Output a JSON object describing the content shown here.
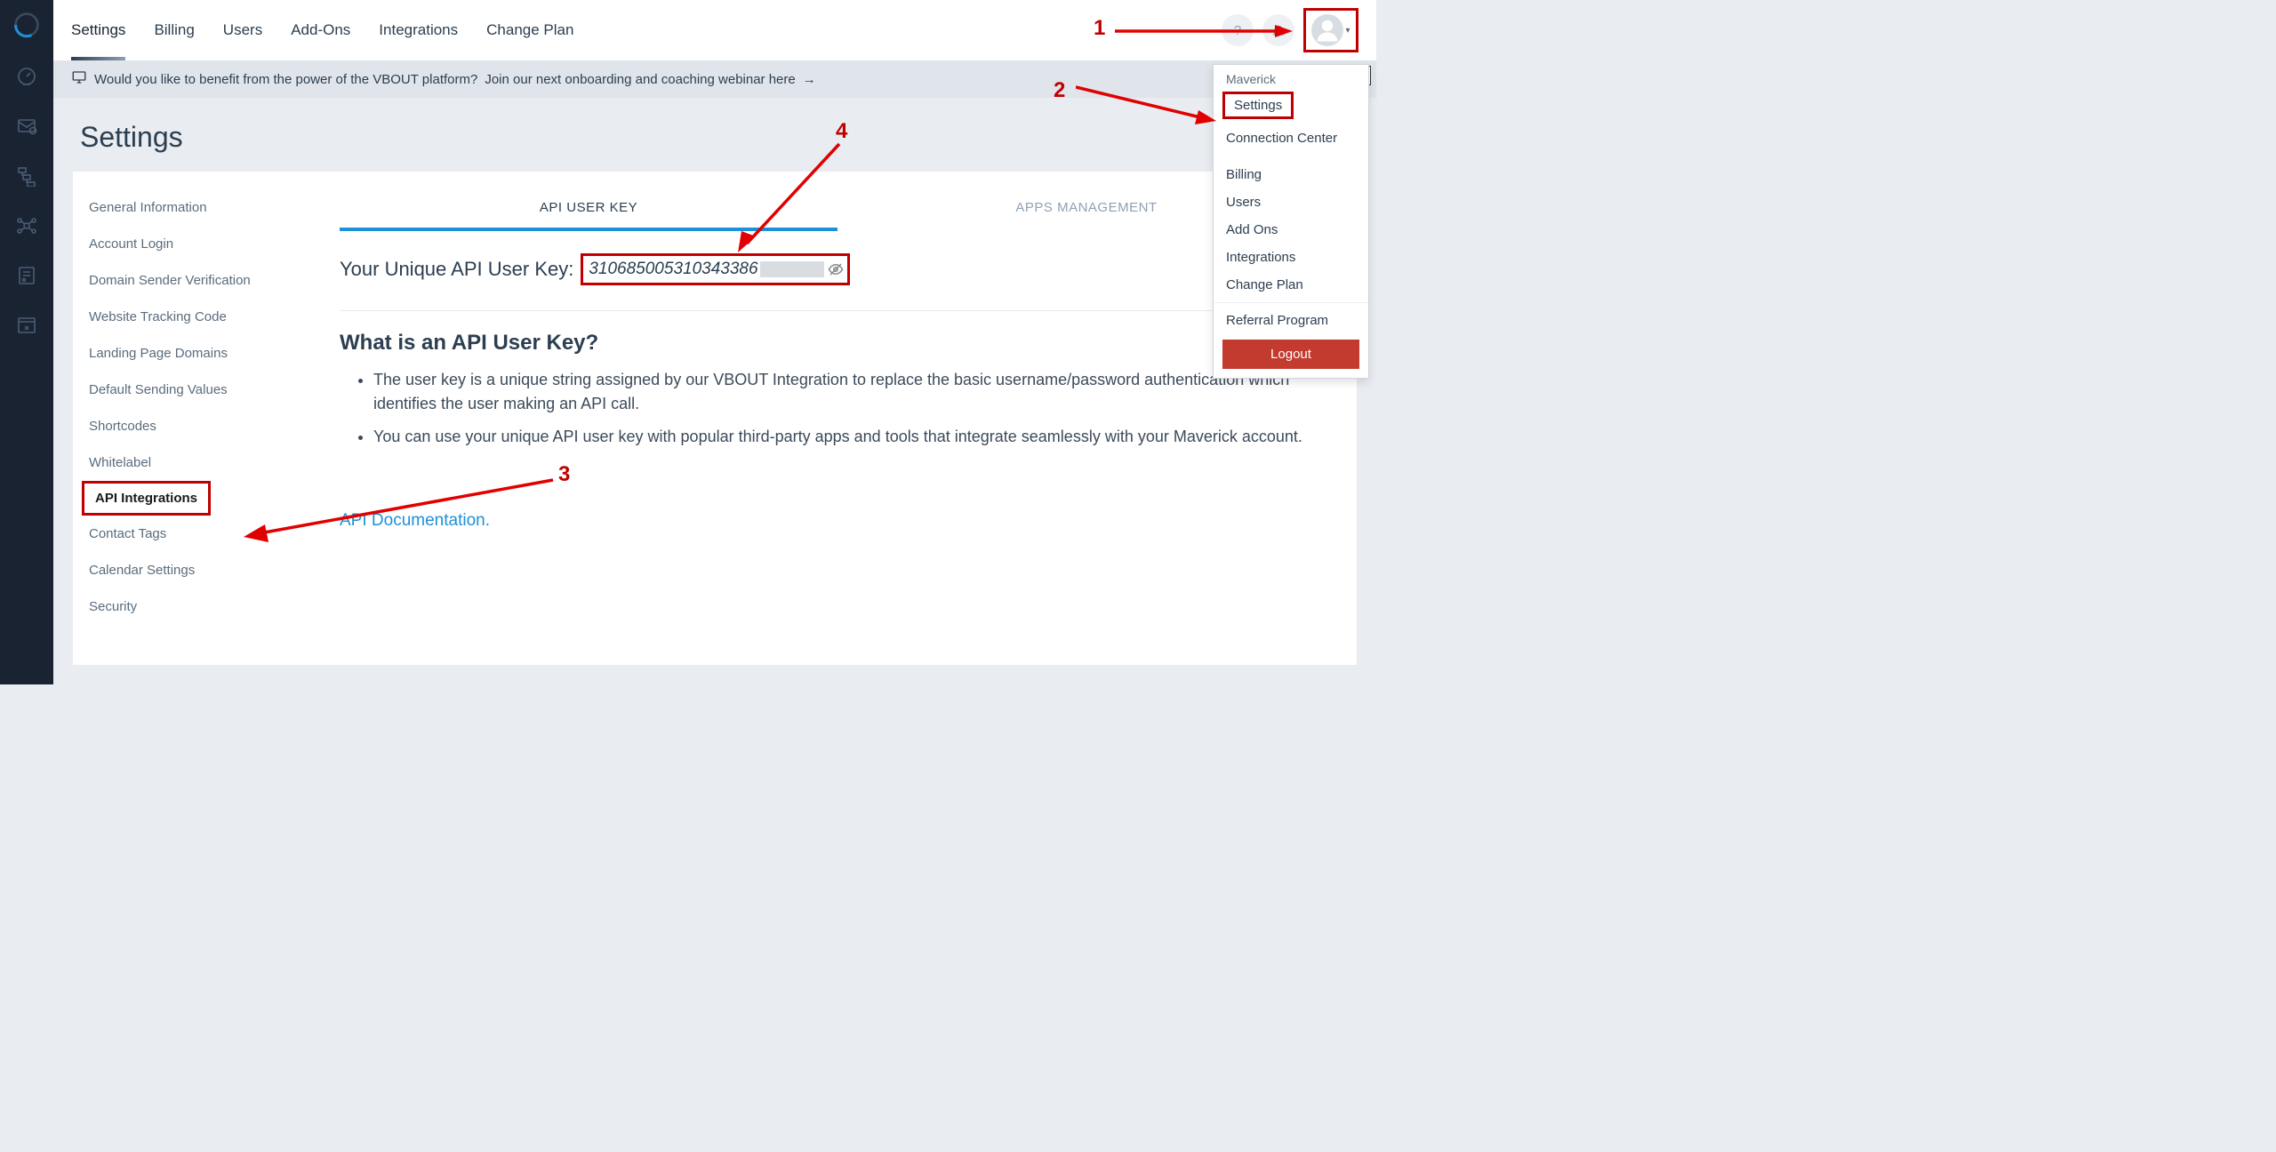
{
  "topTabs": {
    "settings": "Settings",
    "billing": "Billing",
    "users": "Users",
    "addons": "Add-Ons",
    "integrations": "Integrations",
    "changePlan": "Change Plan"
  },
  "banner": {
    "prefix": "Would you like to benefit from the power of the VBOUT platform? ",
    "link": "Join our next onboarding and coaching webinar here"
  },
  "pageTitle": "Settings",
  "settingsNav": {
    "general": "General Information",
    "accountLogin": "Account Login",
    "domainSender": "Domain Sender Verification",
    "tracking": "Website Tracking Code",
    "landing": "Landing Page Domains",
    "defaultSending": "Default Sending Values",
    "shortcodes": "Shortcodes",
    "whitelabel": "Whitelabel",
    "apiIntegrations": "API Integrations",
    "contactTags": "Contact Tags",
    "calendar": "Calendar Settings",
    "security": "Security"
  },
  "panelTabs": {
    "apiUserKey": "API USER KEY",
    "appsManagement": "APPS MANAGEMENT"
  },
  "apiKey": {
    "label": "Your Unique API User Key:",
    "value": "310685005310343386"
  },
  "whatIs": {
    "heading": "What is an API User Key?",
    "b1": "The user key is a unique string assigned by our VBOUT Integration to replace the basic username/password authentication which identifies the user making an API call.",
    "b2": "You can use your unique API user key with popular third-party apps and tools that integrate seamlessly with your Maverick account."
  },
  "docLink": "API Documentation.",
  "dropdown": {
    "name": "Maverick",
    "settings": "Settings",
    "connection": "Connection Center",
    "billing": "Billing",
    "users": "Users",
    "addons": "Add Ons",
    "integrations": "Integrations",
    "changePlan": "Change Plan",
    "referral": "Referral Program",
    "logout": "Logout"
  },
  "annotations": {
    "n1": "1",
    "n2": "2",
    "n3": "3",
    "n4": "4"
  }
}
